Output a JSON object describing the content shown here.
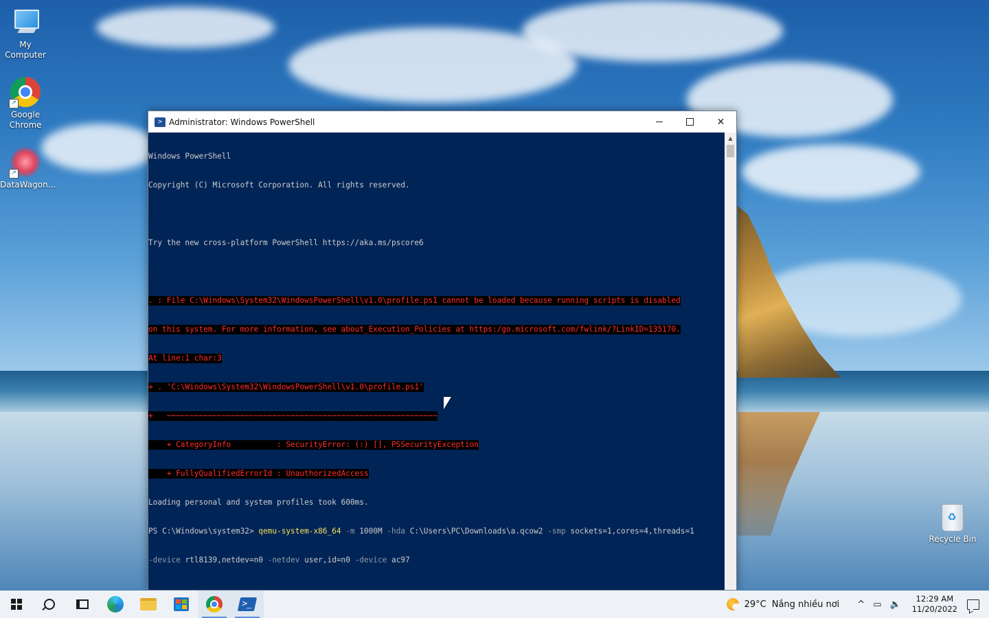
{
  "desktop": {
    "icons": [
      {
        "label_line1": "My",
        "label_line2": "Computer"
      },
      {
        "label_line1": "Google",
        "label_line2": "Chrome"
      },
      {
        "label_line1": "DataWagon...",
        "label_line2": ""
      }
    ],
    "recycle_bin": {
      "label": "Recycle Bin"
    }
  },
  "window": {
    "title": "Administrator: Windows PowerShell",
    "console": {
      "header": [
        "Windows PowerShell",
        "Copyright (C) Microsoft Corporation. All rights reserved.",
        "",
        "Try the new cross-platform PowerShell https://aka.ms/pscore6",
        ""
      ],
      "errors": [
        ". : File C:\\Windows\\System32\\WindowsPowerShell\\v1.0\\profile.ps1 cannot be loaded because running scripts is disabled",
        "on this system. For more information, see about_Execution_Policies at https:/go.microsoft.com/fwlink/?LinkID=135170.",
        "At line:1 char:3",
        "+ . 'C:\\Windows\\System32\\WindowsPowerShell\\v1.0\\profile.ps1'",
        "+   ~~~~~~~~~~~~~~~~~~~~~~~~~~~~~~~~~~~~~~~~~~~~~~~~~~~~~~~~~~~",
        "    + CategoryInfo          : SecurityError: (:) [], PSSecurityException",
        "    + FullyQualifiedErrorId : UnauthorizedAccess"
      ],
      "loading": "Loading personal and system profiles took 600ms.",
      "prompt": "PS C:\\Windows\\system32> ",
      "command": {
        "exe": "qemu-system-x86_64",
        "p1": " -m ",
        "v1": "1000M",
        "p2": " -hda ",
        "v2": "C:\\Users\\PC\\Downloads\\a.qcow2",
        "p3": " -smp ",
        "v3": "sockets=1,cores=4,threads=1",
        "p4": "-device",
        "v4": " rtl8139,netdev=n0 ",
        "p5": "-netdev",
        "v5": " user,id=n0 ",
        "p6": "-device",
        "v6": " ac97"
      }
    }
  },
  "taskbar": {
    "apps": [
      "start",
      "search",
      "task-view",
      "edge",
      "file-explorer",
      "store",
      "chrome",
      "powershell"
    ],
    "weather": {
      "temp": "29°C",
      "desc": "Nắng nhiều nơi"
    },
    "clock": {
      "time": "12:29 AM",
      "date": "11/20/2022"
    },
    "tray_glyphs": {
      "chevron": "^",
      "network": "▭",
      "volume": "🔈"
    }
  }
}
